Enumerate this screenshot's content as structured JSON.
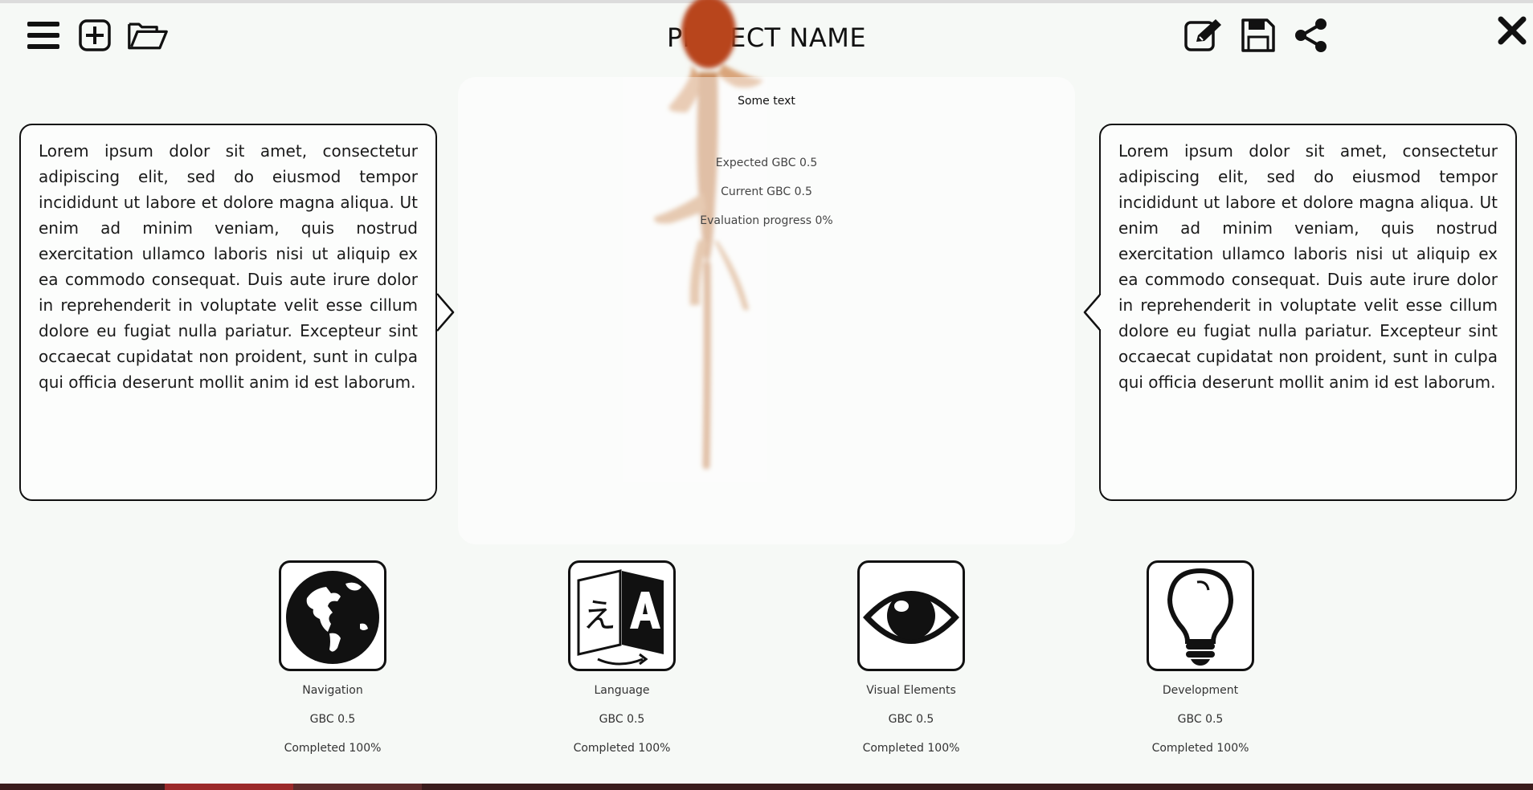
{
  "header": {
    "title": "PROJECT NAME",
    "icons": [
      "menu-icon",
      "add-square-icon",
      "folder-open-icon",
      "edit-icon",
      "save-icon",
      "share-icon",
      "close-icon"
    ]
  },
  "center": {
    "title": "Some text",
    "expected": "Expected GBC 0.5",
    "current": "Current GBC 0.5",
    "progress": "Evaluation progress 0%"
  },
  "left_panel": {
    "text": "Lorem ipsum dolor sit amet, consectetur adipiscing elit, sed do eiusmod tempor incididunt ut labore et dolore magna aliqua. Ut enim ad minim veniam, quis nostrud exercitation ullamco laboris nisi ut aliquip ex ea commodo consequat. Duis aute irure dolor in reprehenderit in voluptate velit esse cillum dolore eu fugiat nulla pariatur. Excepteur sint occaecat cupidatat non proident, sunt in culpa qui officia deserunt mollit anim id est laborum."
  },
  "right_panel": {
    "text": "Lorem ipsum dolor sit amet, consectetur adipiscing elit, sed do eiusmod tempor incididunt ut labore et dolore magna aliqua. Ut enim ad minim veniam, quis nostrud exercitation ullamco laboris nisi ut aliquip ex ea commodo consequat. Duis aute irure dolor in reprehenderit in voluptate velit esse cillum dolore eu fugiat nulla pariatur. Excepteur sint occaecat cupidatat non proident, sunt in culpa qui officia deserunt mollit anim id est laborum."
  },
  "categories": [
    {
      "label": "Navigation",
      "gbc": "GBC 0.5",
      "completed": "Completed 100%",
      "icon": "globe-icon"
    },
    {
      "label": "Language",
      "gbc": "GBC 0.5",
      "completed": "Completed 100%",
      "icon": "translate-icon"
    },
    {
      "label": "Visual Elements",
      "gbc": "GBC 0.5",
      "completed": "Completed 100%",
      "icon": "eye-icon"
    },
    {
      "label": "Development",
      "gbc": "GBC 0.5",
      "completed": "Completed 100%",
      "icon": "lightbulb-icon"
    }
  ],
  "colors": {
    "background": "#f6f9f6",
    "ink": "#111111",
    "gecko": "#c8743f"
  }
}
